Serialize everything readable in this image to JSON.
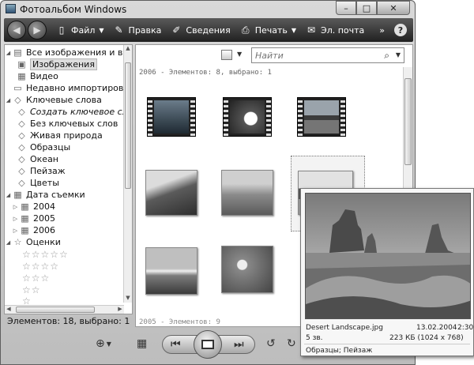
{
  "window": {
    "title": "Фотоальбом Windows"
  },
  "toolbar": {
    "file": "Файл",
    "edit": "Правка",
    "info": "Сведения",
    "print": "Печать",
    "email": "Эл. почта",
    "more": "»",
    "help": "?"
  },
  "nav": {
    "all": "Все изображения и видео",
    "images": "Изображения",
    "video": "Видео",
    "recent": "Недавно импортированные",
    "tags": "Ключевые слова",
    "create_tag": "Создать ключевое слово",
    "no_tags": "Без ключевых слов",
    "tag1": "Живая природа",
    "tag2": "Образцы",
    "tag3": "Океан",
    "tag4": "Пейзаж",
    "tag5": "Цветы",
    "date": "Дата съемки",
    "y2004": "2004",
    "y2005": "2005",
    "y2006": "2006",
    "ratings": "Оценки",
    "rating_row_5": "☆☆☆☆☆",
    "rating_row_4": "☆☆☆☆",
    "rating_row_3": "☆☆☆",
    "rating_row_2": "☆☆",
    "rating_row_1": "☆"
  },
  "status": "Элементов: 18, выбрано: 1",
  "search": {
    "placeholder": "Найти"
  },
  "groups": {
    "g1": "2006 - Элементов: 8, выбрано: 1",
    "g2": "2005 - Элементов: 9"
  },
  "preview": {
    "filename": "Desert Landscape.jpg",
    "date": "13.02.2004",
    "time": "2:30",
    "rating": "5 зв.",
    "size": "223 КБ (1024 x 768)",
    "tags": "Образцы; Пейзаж"
  }
}
